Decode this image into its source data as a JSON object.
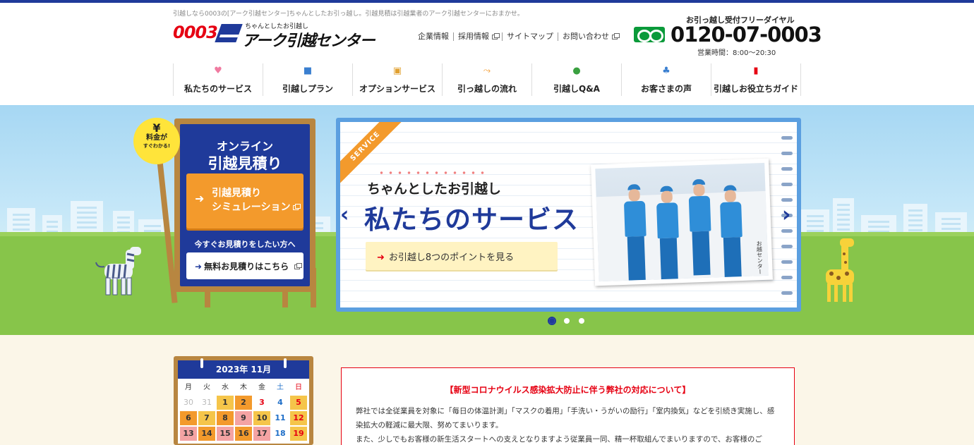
{
  "header": {
    "tagline": "引越しなら0003の[アーク引越センター]ちゃんとしたお引っ越し。引越見積は引越業者のアーク引越センターにおまかせ。",
    "logo": {
      "number": "0003",
      "sub": "ちゃんとしたお引越し",
      "name": "アーク引越センター"
    },
    "utility_links": [
      {
        "label": "企業情報",
        "external": false
      },
      {
        "label": "採用情報",
        "external": true
      },
      {
        "label": "サイトマップ",
        "external": false
      },
      {
        "label": "お問い合わせ",
        "external": true
      }
    ],
    "phone": {
      "label": "お引っ越し受付フリーダイヤル",
      "number": "0120-07-0003",
      "hours": "営業時間：8:00～20:30"
    }
  },
  "nav": [
    {
      "label": "私たちのサービス",
      "icon": "heart-icon",
      "glyph": "♥",
      "color": "#f07aa0"
    },
    {
      "label": "引越しプラン",
      "icon": "truck-icon",
      "glyph": "■",
      "color": "#3a7fd0"
    },
    {
      "label": "オプションサービス",
      "icon": "box-icon",
      "glyph": "▣",
      "color": "#e0a030"
    },
    {
      "label": "引っ越しの流れ",
      "icon": "flow-arrow-icon",
      "glyph": "⤳",
      "color": "#f39a2c"
    },
    {
      "label": "引越しQ&A",
      "icon": "question-icon",
      "glyph": "●",
      "color": "#3aa040"
    },
    {
      "label": "お客さまの声",
      "icon": "customers-icon",
      "glyph": "♣",
      "color": "#3a7fd0"
    },
    {
      "label": "引越しお役立ちガイド",
      "icon": "guide-book-icon",
      "glyph": "▮",
      "color": "#e60012"
    }
  ],
  "estimate_board": {
    "badge": {
      "symbol": "¥",
      "line1": "料金が",
      "line2": "すぐわかる!"
    },
    "title_line1": "オンライン",
    "title_line2": "引越見積り",
    "simulation_button": {
      "line1": "引越見積り",
      "line2": "シミュレーション"
    },
    "now_text": "今すぐお見積りをしたい方へ",
    "free_button": "無料お見積りはこちら"
  },
  "slider": {
    "ribbon": "SERVICE",
    "subtitle": "ちゃんとしたお引越し",
    "title": "私たちのサービス",
    "points_button": "お引越し8つのポイントを見る",
    "photo_sign": "お越センター",
    "dots": [
      {
        "active": true
      },
      {
        "active": false
      },
      {
        "active": false
      }
    ]
  },
  "calendar": {
    "month": "2023年 11月",
    "weekdays": [
      "月",
      "火",
      "水",
      "木",
      "金",
      "土",
      "日"
    ],
    "rows": [
      [
        {
          "d": "30",
          "s": "muted"
        },
        {
          "d": "31",
          "s": "muted"
        },
        {
          "d": "1",
          "s": "y"
        },
        {
          "d": "2",
          "s": "o"
        },
        {
          "d": "3",
          "s": "sun"
        },
        {
          "d": "4",
          "s": "sat"
        },
        {
          "d": "5",
          "s": "y sun"
        }
      ],
      [
        {
          "d": "6",
          "s": "o"
        },
        {
          "d": "7",
          "s": "y"
        },
        {
          "d": "8",
          "s": "o"
        },
        {
          "d": "9",
          "s": "p"
        },
        {
          "d": "10",
          "s": "y"
        },
        {
          "d": "11",
          "s": "sat"
        },
        {
          "d": "12",
          "s": "y sun"
        }
      ],
      [
        {
          "d": "13",
          "s": "p"
        },
        {
          "d": "14",
          "s": "o"
        },
        {
          "d": "15",
          "s": "p"
        },
        {
          "d": "16",
          "s": "o"
        },
        {
          "d": "17",
          "s": "p"
        },
        {
          "d": "18",
          "s": "sat"
        },
        {
          "d": "19",
          "s": "y sun"
        }
      ]
    ]
  },
  "notice": {
    "title": "【新型コロナウイルス感染拡大防止に伴う弊社の対応について】",
    "paragraphs": [
      "弊社では全従業員を対象に「毎日の体温計測」「マスクの着用」「手洗い・うがいの励行」「室内換気」などを引続き実施し、感染拡大の軽減に最大限、努めてまいります。",
      "また、少しでもお客様の新生活スタートへの支えとなりますよう従業員一同、精一杯取組んでまいりますので、お客様のご"
    ]
  }
}
